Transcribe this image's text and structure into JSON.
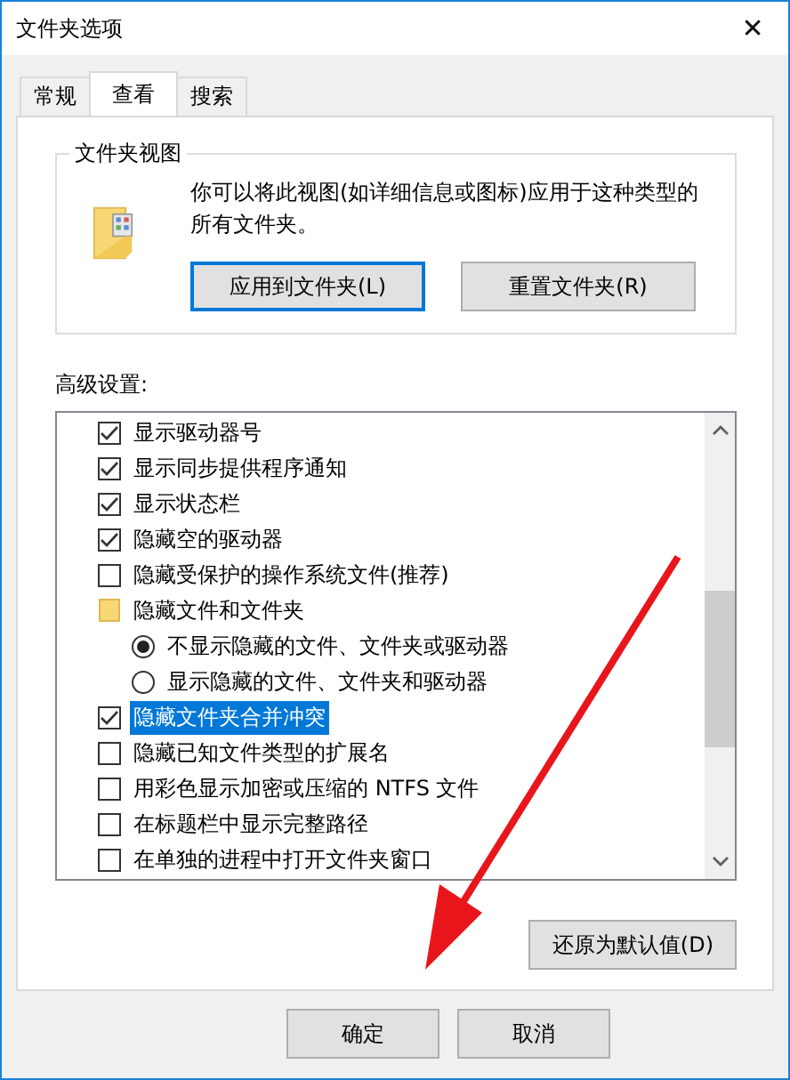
{
  "window": {
    "title": "文件夹选项",
    "close": "✕"
  },
  "tabs": [
    {
      "label": "常规",
      "selected": false
    },
    {
      "label": "查看",
      "selected": true
    },
    {
      "label": "搜索",
      "selected": false
    }
  ],
  "folder_views": {
    "title": "文件夹视图",
    "description": "你可以将此视图(如详细信息或图标)应用于这种类型的所有文件夹。",
    "buttons": [
      {
        "label": "应用到文件夹(L)",
        "selected": true
      },
      {
        "label": "重置文件夹(R)",
        "selected": false
      }
    ]
  },
  "advanced": {
    "title": "高级设置:",
    "items": [
      {
        "kind": "checkbox",
        "label": "显示驱动器号",
        "checked": true,
        "selected": false
      },
      {
        "kind": "checkbox",
        "label": "显示同步提供程序通知",
        "checked": true,
        "selected": false
      },
      {
        "kind": "checkbox",
        "label": "显示状态栏",
        "checked": true,
        "selected": false
      },
      {
        "kind": "checkbox",
        "label": "隐藏空的驱动器",
        "checked": true,
        "selected": false
      },
      {
        "kind": "checkbox",
        "label": "隐藏受保护的操作系统文件(推荐)",
        "checked": false,
        "selected": false
      },
      {
        "kind": "folder",
        "label": "隐藏文件和文件夹",
        "selected": false,
        "children": [
          {
            "kind": "radio",
            "label": "不显示隐藏的文件、文件夹或驱动器",
            "checked": true,
            "selected": false
          },
          {
            "kind": "radio",
            "label": "显示隐藏的文件、文件夹和驱动器",
            "checked": false,
            "selected": false
          }
        ]
      },
      {
        "kind": "checkbox",
        "label": "隐藏文件夹合并冲突",
        "checked": true,
        "selected": true
      },
      {
        "kind": "checkbox",
        "label": "隐藏已知文件类型的扩展名",
        "checked": false,
        "selected": false
      },
      {
        "kind": "checkbox",
        "label": "用彩色显示加密或压缩的 NTFS 文件",
        "checked": false,
        "selected": false
      },
      {
        "kind": "checkbox",
        "label": "在标题栏中显示完整路径",
        "checked": false,
        "selected": false
      },
      {
        "kind": "checkbox",
        "label": "在单独的进程中打开文件夹窗口",
        "checked": false,
        "selected": false
      }
    ],
    "restore_button": "还原为默认值(D)"
  },
  "buttons": [
    "确定",
    "取消"
  ]
}
